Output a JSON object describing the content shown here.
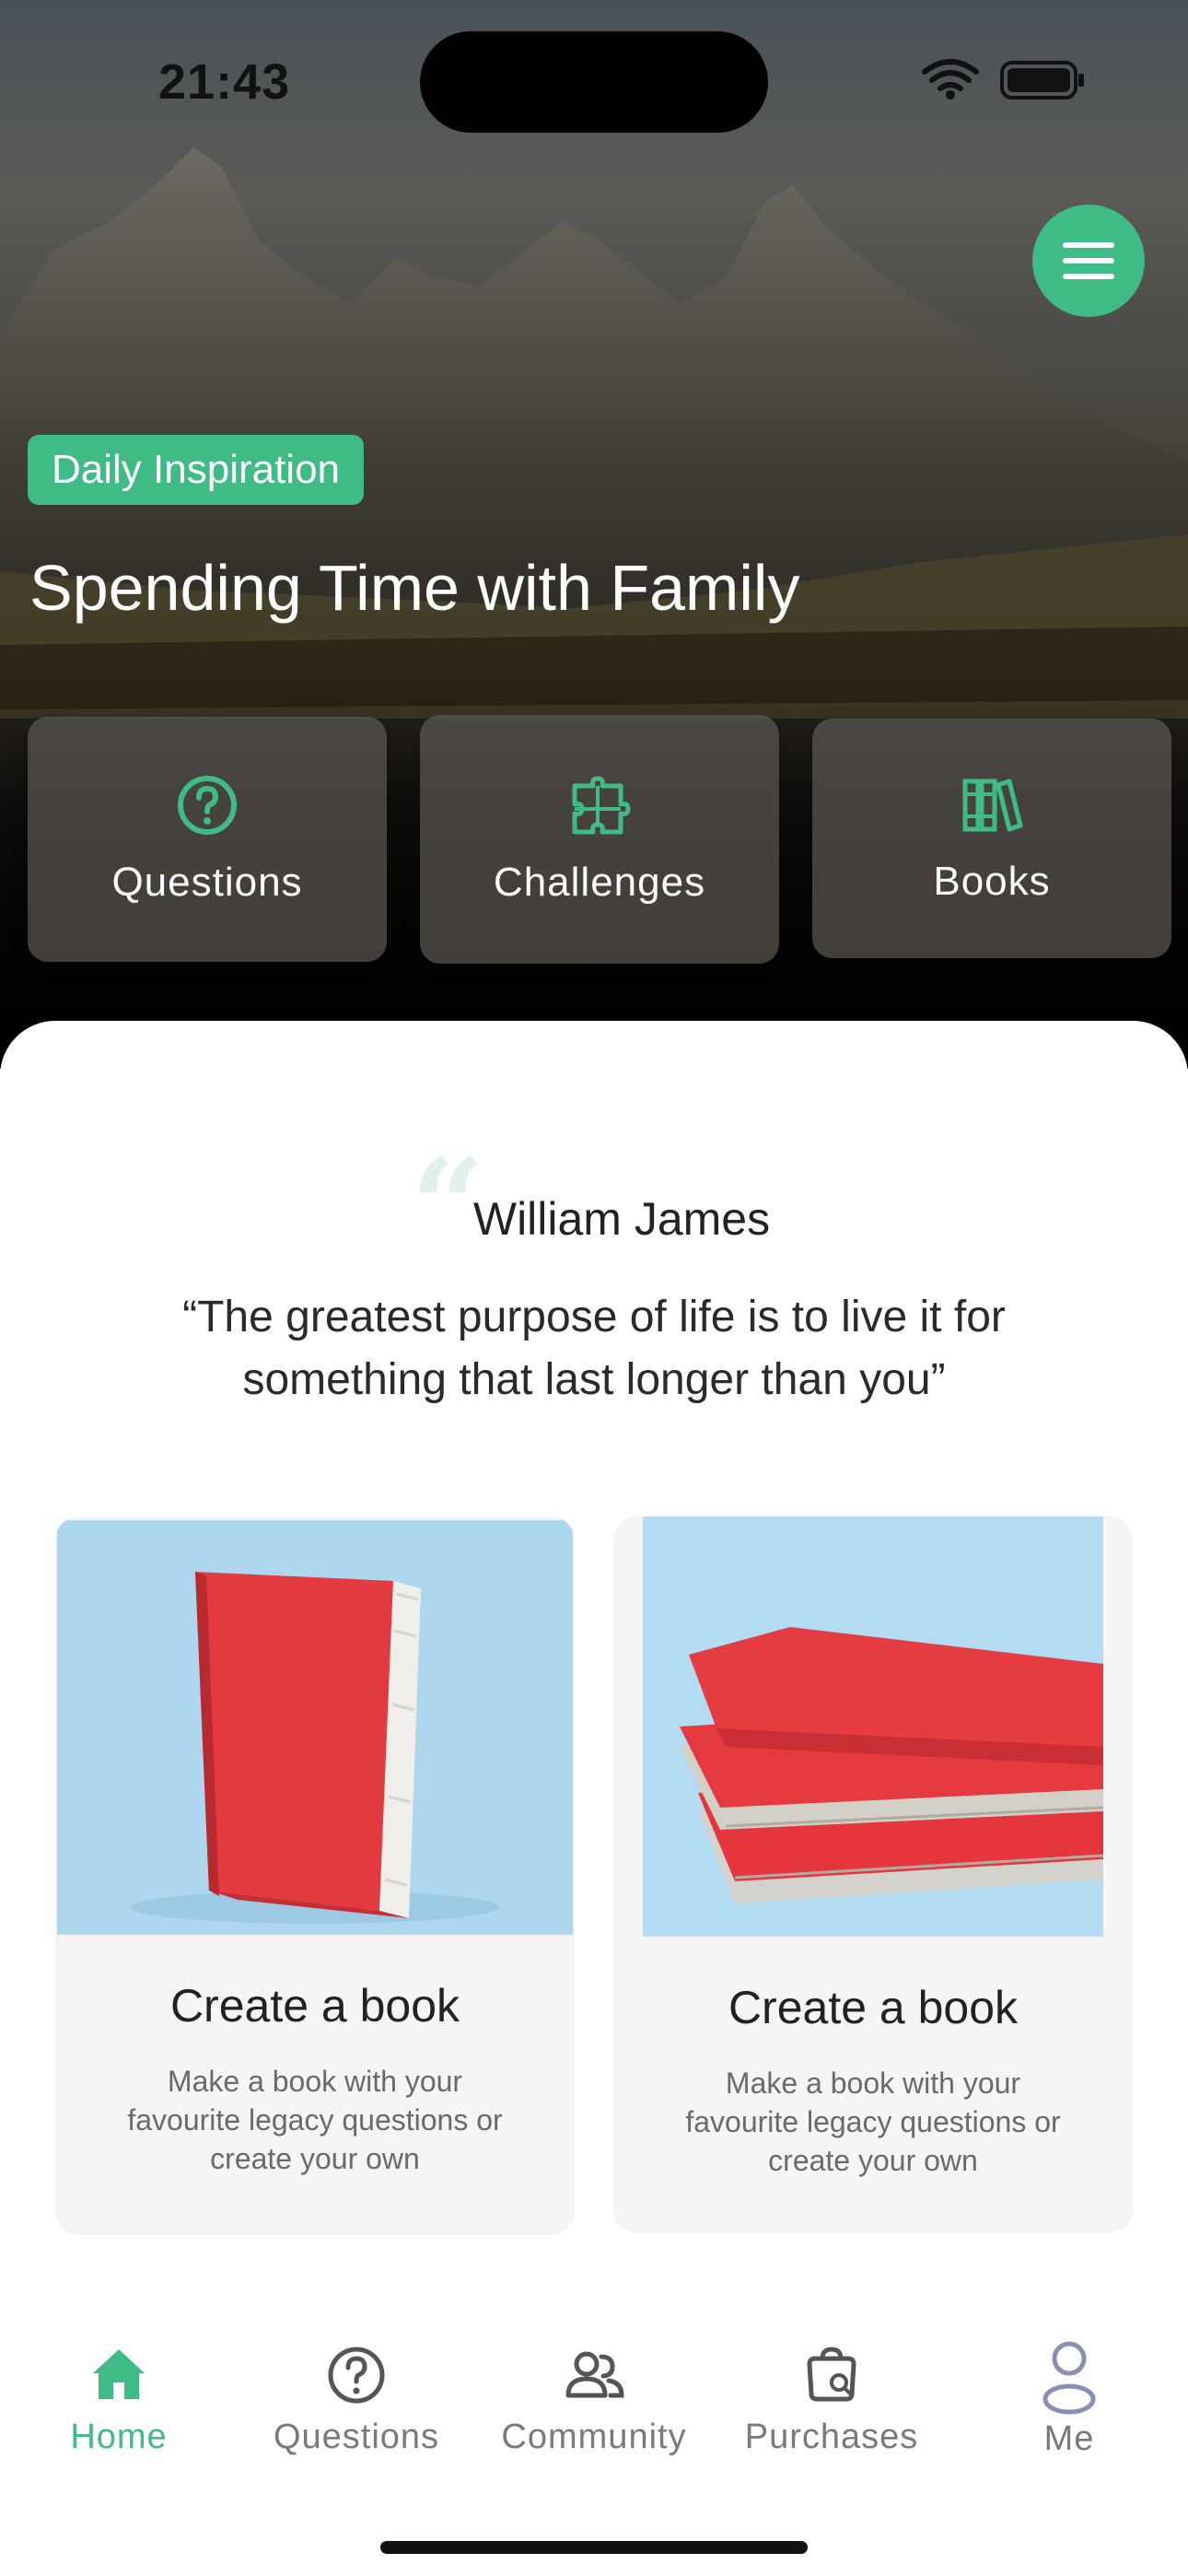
{
  "status": {
    "time": "21:43"
  },
  "hero": {
    "badge": "Daily Inspiration",
    "title": "Spending Time with Family",
    "tiles": [
      {
        "label": "Questions",
        "icon": "question-circle-icon"
      },
      {
        "label": "Challenges",
        "icon": "puzzle-icon"
      },
      {
        "label": "Books",
        "icon": "books-icon"
      }
    ]
  },
  "quote": {
    "author": "William James",
    "text": "“The greatest purpose of life is to live it for something that last longer than you”"
  },
  "cards": [
    {
      "title": "Create a book",
      "description": "Make a book with your favourite legacy questions or create your own"
    },
    {
      "title": "Create a book",
      "description": "Make a book with your favourite legacy questions or create your own"
    }
  ],
  "tabbar": {
    "items": [
      {
        "label": "Home",
        "icon": "home-icon",
        "active": true
      },
      {
        "label": "Questions",
        "icon": "question-circle-icon",
        "active": false
      },
      {
        "label": "Community",
        "icon": "people-icon",
        "active": false
      },
      {
        "label": "Purchases",
        "icon": "bag-icon",
        "active": false
      },
      {
        "label": "Me",
        "icon": "person-icon",
        "active": false
      }
    ]
  },
  "colors": {
    "accent": "#3fbb86",
    "sheet": "#ffffff",
    "card": "#f5f5f5",
    "book_red": "#e8383f",
    "photo_blue": "#aed7ef"
  }
}
